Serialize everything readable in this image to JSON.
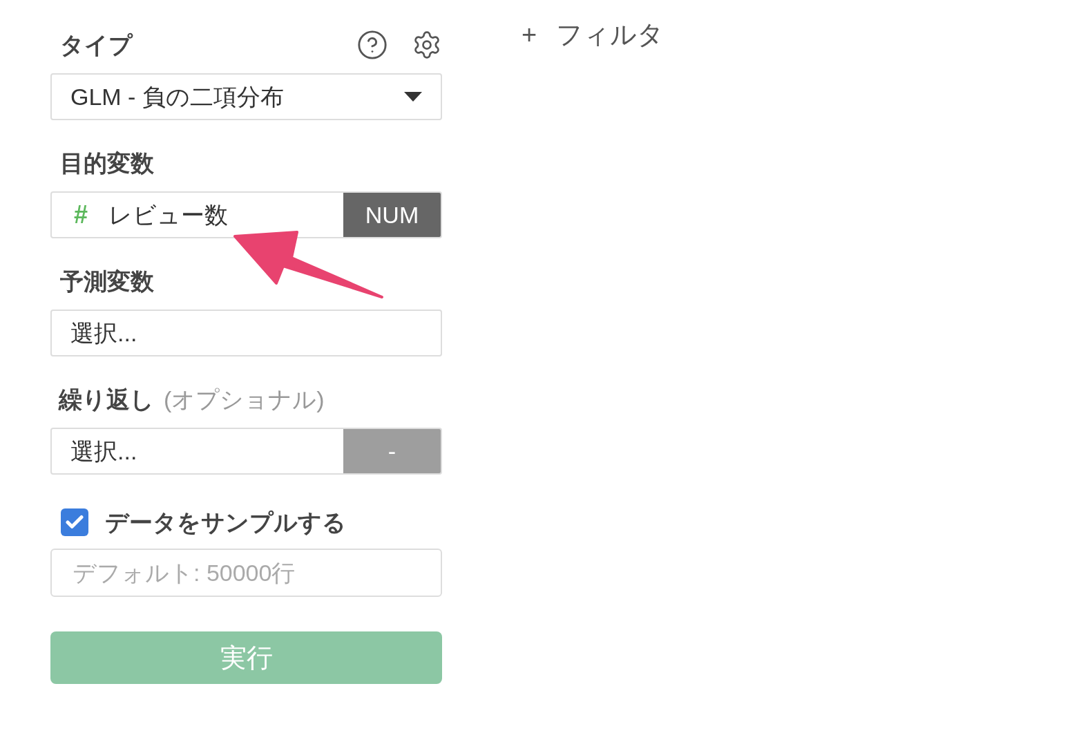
{
  "type": {
    "label": "タイプ",
    "value": "GLM - 負の二項分布"
  },
  "target": {
    "label": "目的変数",
    "icon": "#",
    "value": "レビュー数",
    "badge": "NUM"
  },
  "predictors": {
    "label": "予測変数",
    "placeholder": "選択..."
  },
  "repeat": {
    "label": "繰り返し",
    "note": "(オプショナル)",
    "placeholder": "選択...",
    "badge": "-"
  },
  "sample": {
    "label": "データをサンプルする",
    "checked": true,
    "placeholder": "デフォルト: 50000行"
  },
  "run_button": {
    "label": "実行",
    "disabled": true
  },
  "filter": {
    "icon": "+",
    "label": "フィルタ"
  }
}
